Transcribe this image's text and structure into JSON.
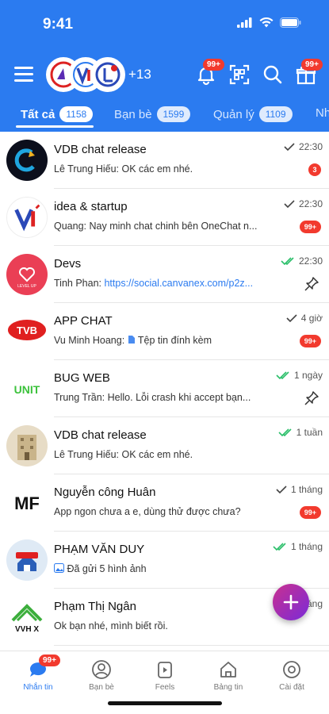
{
  "status_bar": {
    "time": "9:41"
  },
  "header": {
    "more_avatars": "+13",
    "notification_badge": "99+",
    "gift_badge": "99+",
    "icons": [
      "menu-icon",
      "bell-icon",
      "qr-scan-icon",
      "search-icon",
      "gift-icon"
    ]
  },
  "tabs": [
    {
      "label": "Tất cả",
      "count": "1158"
    },
    {
      "label": "Bạn bè",
      "count": "1599"
    },
    {
      "label": "Quản lý",
      "count": "1109"
    },
    {
      "label": "Nh",
      "count": ""
    }
  ],
  "chats": [
    {
      "name": "VDB chat release",
      "sender": "Lê Trung Hiếu:",
      "message": "OK các em nhé.",
      "time": "22:30",
      "check": "single",
      "badge": "3"
    },
    {
      "name": "idea & startup",
      "sender": "Quang:",
      "message": "Nay minh chat chinh bên OneChat n...",
      "time": "22:30",
      "check": "single",
      "badge": "99+"
    },
    {
      "name": "Devs",
      "sender": "Tinh Phan:",
      "message": "https://social.canvanex.com/p2z...",
      "time": "22:30",
      "check": "double",
      "pinned": true
    },
    {
      "name": "APP CHAT",
      "sender": "Vu Minh Hoang:",
      "message": "Tệp tin đính kèm",
      "time": "4 giờ",
      "check": "single",
      "badge": "99+"
    },
    {
      "name": "BUG WEB",
      "sender": "Trung Trần:",
      "message": "Hello. Lỗi crash khi accept bạn...",
      "time": "1 ngày",
      "check": "double",
      "pinned": true
    },
    {
      "name": "VDB chat release",
      "sender": "Lê Trung Hiếu:",
      "message": "OK các em nhé.",
      "time": "1 tuần",
      "check": "double"
    },
    {
      "name": "Nguyễn công Huân",
      "sender": "",
      "message": "App ngon chưa a e, dùng thử được chưa?",
      "time": "1 tháng",
      "check": "single",
      "badge": "99+"
    },
    {
      "name": "PHẠM VĂN DUY",
      "sender": "",
      "message": "Đã gửi 5 hình ảnh",
      "time": "1 tháng",
      "check": "double"
    },
    {
      "name": "Phạm Thị Ngân",
      "sender": "",
      "message": "Ok bạn nhé, mình biết rồi.",
      "time": "1 tháng",
      "check": "double"
    }
  ],
  "avatar_labels": {
    "tvb": "TVB",
    "unit": "UNIT",
    "mf": "MF",
    "vvh": "VVH X",
    "levelup": "LEVEL UP"
  },
  "bottom_nav": [
    {
      "label": "Nhắn tin",
      "badge": "99+"
    },
    {
      "label": "Bạn bè"
    },
    {
      "label": "Feels"
    },
    {
      "label": "Bảng tin"
    },
    {
      "label": "Cài đặt"
    }
  ],
  "colors": {
    "primary": "#2b7bf0",
    "badge": "#f23a2e",
    "check_green": "#2bbf6a"
  }
}
